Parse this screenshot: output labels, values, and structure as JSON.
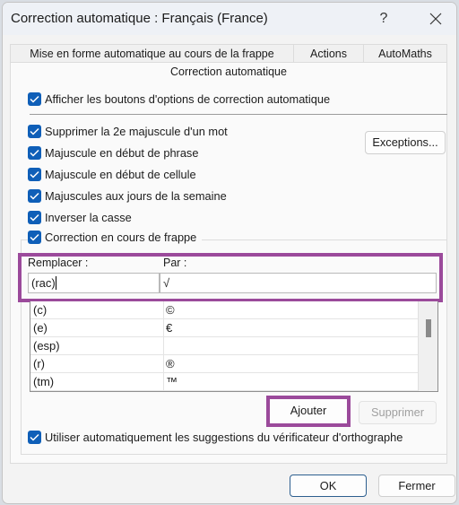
{
  "window": {
    "title": "Correction automatique : Français (France)",
    "help_label": "?",
    "close_icon": "close-icon"
  },
  "tabs": [
    {
      "label": "Mise en forme automatique au cours de la frappe",
      "active": false
    },
    {
      "label": "Actions",
      "active": false
    },
    {
      "label": "AutoMaths",
      "active": false
    },
    {
      "label": "Correction automatique",
      "active": true
    }
  ],
  "options": {
    "show_buttons": {
      "label": "Afficher les boutons d'options de correction automatique",
      "checked": true
    },
    "two_initial_caps": {
      "label": "Supprimer la 2e majuscule d'un mot",
      "checked": true
    },
    "capitalize_sentence": {
      "label": "Majuscule en début de phrase",
      "checked": true
    },
    "capitalize_cell": {
      "label": "Majuscule en début de cellule",
      "checked": true
    },
    "capitalize_days": {
      "label": "Majuscules aux jours de la semaine",
      "checked": true
    },
    "caps_lock": {
      "label": "Inverser la casse",
      "checked": true
    },
    "replace_text": {
      "label": "Correction en cours de frappe",
      "checked": true
    },
    "spell_suggestions": {
      "label": "Utiliser automatiquement les suggestions du vérificateur d'orthographe",
      "checked": true
    }
  },
  "exceptions_button": "Exceptions...",
  "replace": {
    "replace_label": "Remplacer :",
    "with_label": "Par :",
    "replace_value": "(rac)",
    "with_value": "√"
  },
  "entries": [
    {
      "replace": "(c)",
      "with": "©"
    },
    {
      "replace": "(e)",
      "with": "€"
    },
    {
      "replace": "(esp)",
      "with": ""
    },
    {
      "replace": "(r)",
      "with": "®"
    },
    {
      "replace": "(tm)",
      "with": "™"
    }
  ],
  "buttons": {
    "add": "Ajouter",
    "delete": "Supprimer",
    "ok": "OK",
    "close": "Fermer"
  },
  "colors": {
    "checkbox": "#0f5fb8",
    "highlight": "#9b4a9b"
  }
}
